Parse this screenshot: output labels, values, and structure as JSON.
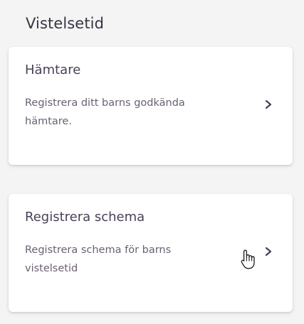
{
  "section": {
    "title": "Vistelsetid"
  },
  "cards": [
    {
      "title": "Hämtare",
      "description_line1": "Registrera ditt barns godkända",
      "description_line2": "hämtare.",
      "chevron_icon": "chevron-right-icon"
    },
    {
      "title": "Registrera schema",
      "description_line1": "Registrera schema för barns",
      "description_line2": "vistelsetid",
      "chevron_icon": "chevron-right-icon"
    }
  ],
  "cursor": {
    "icon": "hand-pointer-cursor-icon"
  },
  "colors": {
    "background": "#f4f4f5",
    "card": "#ffffff",
    "title_text": "#3a3442",
    "card_title_text": "#4a4055",
    "description_text": "#6a5f73",
    "chevron": "#4a4055"
  }
}
